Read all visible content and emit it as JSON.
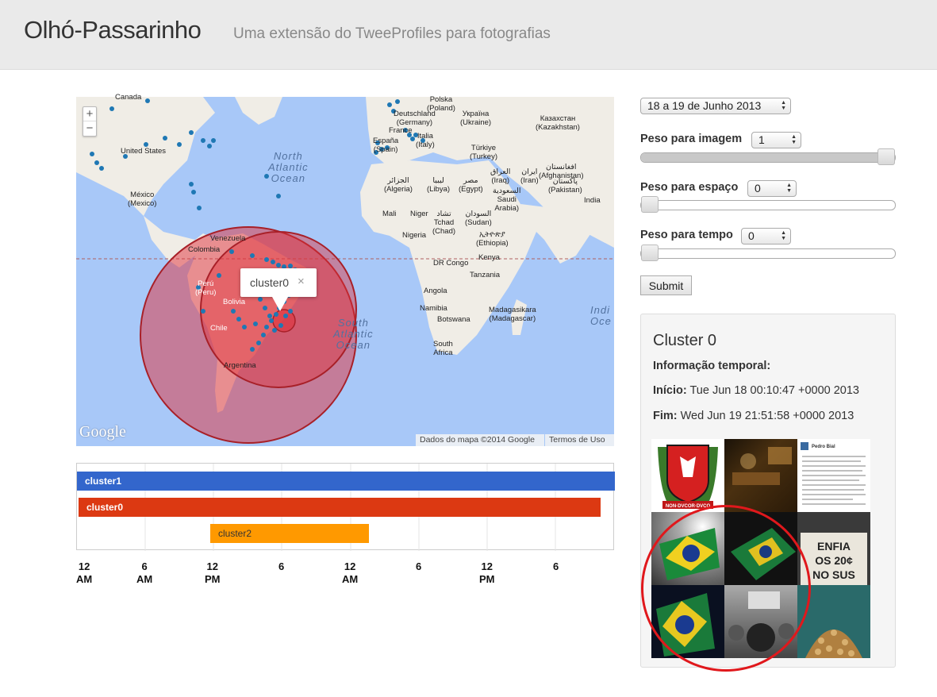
{
  "header": {
    "title": "Olhó-Passarinho",
    "subtitle": "Uma extensão do TweeProfiles para fotografias"
  },
  "map": {
    "zoom_in": "+",
    "zoom_out": "−",
    "labels": {
      "canada": "Canada",
      "poland": "Polska\n(Poland)",
      "deutschland": "Deutschland\n(Germany)",
      "ukraine": "Україна\n(Ukraine)",
      "kazakhstan": "Казахстан\n(Kazakhstan)",
      "united_states": "United States",
      "france": "France",
      "espana": "España\n(Spain)",
      "italia": "Italia\n(Italy)",
      "turkey": "Türkiye\n(Turkey)",
      "iraq": "العراق\n(Iraq)",
      "iran": "ایران\n(Iran)",
      "afghanistan": "افغانستان\n(Afghanistan)",
      "pakistan": "پاکستان\n(Pakistan)",
      "algeria": "الجزائر\n(Algeria)",
      "libya": "ليبيا\n(Libya)",
      "egypt": "مصر\n(Egypt)",
      "saudi": "السعودية\nSaudi\nArabia)",
      "india": "India",
      "mexico": "México\n(Mexico)",
      "mali": "Mali",
      "niger": "Niger",
      "chad": "تشاد\nTchad\n(Chad)",
      "sudan": "السودان\n(Sudan)",
      "ethiopia": "ኢትዮጵያ\n(Ethiopia)",
      "venezuela": "Venezuela",
      "colombia": "Colombia",
      "nigeria": "Nigeria",
      "drcongo": "DR Congo",
      "kenya": "Kenya",
      "tanzania": "Tanzania",
      "peru": "Perú\n(Peru)",
      "bolivia": "Bolivia",
      "angola": "Angola",
      "namibia": "Namibia",
      "botswana": "Botswana",
      "madagascar": "Madagasikara\n(Madagascar)",
      "chile": "Chile",
      "argentina": "Argentina",
      "south_africa": "South\nAfrica"
    },
    "oceans": {
      "north_atlantic": "North\nAtlantic\nOcean",
      "south_atlantic": "South\nAtlantic\nOcean",
      "indian": "Indi\nOce"
    },
    "popup": {
      "label": "cluster0",
      "close": "×"
    },
    "google_logo": "Google",
    "attribution_data": "Dados do mapa ©2014 Google",
    "attribution_terms": "Termos de Uso"
  },
  "timeline": {
    "bars": [
      {
        "label": "cluster1",
        "color": "#3366cc"
      },
      {
        "label": "cluster0",
        "color": "#dc3912"
      },
      {
        "label": "cluster2",
        "color": "#ff9900"
      }
    ],
    "ticks": [
      {
        "top": "12",
        "bottom": "AM"
      },
      {
        "top": "6",
        "bottom": "AM"
      },
      {
        "top": "12",
        "bottom": "PM"
      },
      {
        "top": "6",
        "bottom": ""
      },
      {
        "top": "12",
        "bottom": "AM"
      },
      {
        "top": "6",
        "bottom": ""
      },
      {
        "top": "12",
        "bottom": "PM"
      },
      {
        "top": "6",
        "bottom": ""
      }
    ]
  },
  "controls": {
    "date_select": "18 a 19 de Junho 2013",
    "peso_imagem_label": "Peso para imagem",
    "peso_imagem_value": "1",
    "peso_imagem_level": 1.0,
    "peso_espaco_label": "Peso para espaço",
    "peso_espaco_value": "0",
    "peso_espaco_level": 0.0,
    "peso_tempo_label": "Peso para tempo",
    "peso_tempo_value": "0",
    "peso_tempo_level": 0.0,
    "submit": "Submit"
  },
  "cluster_panel": {
    "title": "Cluster 0",
    "info_heading": "Informação temporal:",
    "inicio_label": "Início:",
    "inicio_value": " Tue Jun 18 00:10:47 +0000 2013",
    "fim_label": "Fim:",
    "fim_value": " Wed Jun 19 21:51:58 +0000 2013",
    "photos": {
      "sign_text_1": "ENFIA",
      "sign_text_2": "OS 20¢",
      "sign_text_3": "NO SUS",
      "post_author": "Pedro Bial",
      "crest_text": "NON·DVCOR·DVCO"
    }
  },
  "colors": {
    "header_bg": "#eaeaea",
    "water": "#a8c8f8",
    "land": "#f0ede6",
    "cluster_fill": "#e0303a",
    "marker": "#1f78b4",
    "highlight_circle": "#e0181c"
  }
}
